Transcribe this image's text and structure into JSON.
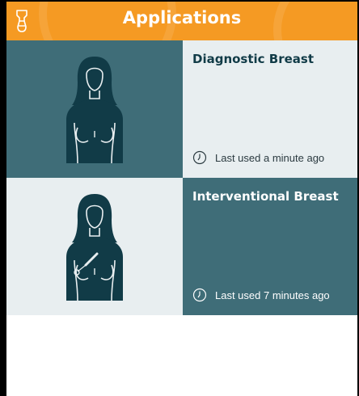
{
  "header": {
    "title": "Applications",
    "back_icon": "hand-scanner-icon",
    "color": "#f59a23"
  },
  "apps": [
    {
      "name": "Diagnostic Breast",
      "last_used": "Last used a minute ago",
      "icon": "diagnostic-breast-figure-icon"
    },
    {
      "name": "Interventional Breast",
      "last_used": "Last used 7 minutes ago",
      "icon": "interventional-breast-figure-icon"
    }
  ],
  "colors": {
    "teal": "#3f6d78",
    "light": "#e8eef0",
    "figure": "#113b47"
  }
}
